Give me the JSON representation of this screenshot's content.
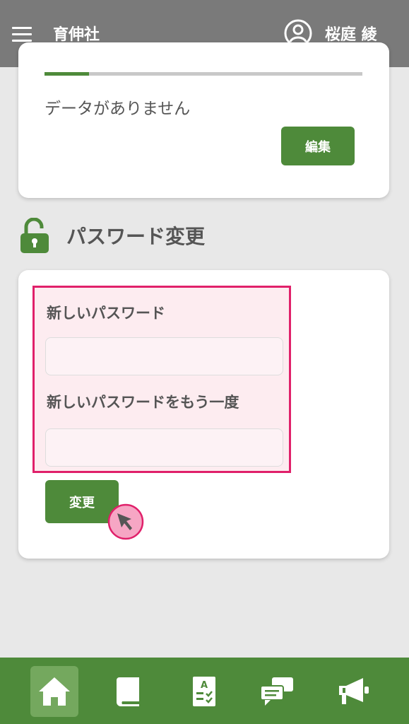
{
  "header": {
    "app_title": "育伸社",
    "user_name": "桜庭 綾"
  },
  "data_card": {
    "progress": 0.14,
    "empty_message": "データがありません",
    "edit_button": "編集"
  },
  "password_section": {
    "title": "パスワード変更",
    "new_password_label": "新しいパスワード",
    "new_password_value": "",
    "confirm_password_label": "新しいパスワードをもう一度",
    "confirm_password_value": "",
    "change_button": "変更"
  },
  "bottom_nav": {
    "items": [
      "home-icon",
      "book-icon",
      "test-sheet-icon",
      "chat-icon",
      "megaphone-icon"
    ],
    "active": "home-icon"
  },
  "colors": {
    "header_bg": "#7a7a7a",
    "accent_green": "#4e8a3a",
    "highlight_pink": "#e0206a",
    "page_bg": "#e8e8e8"
  }
}
